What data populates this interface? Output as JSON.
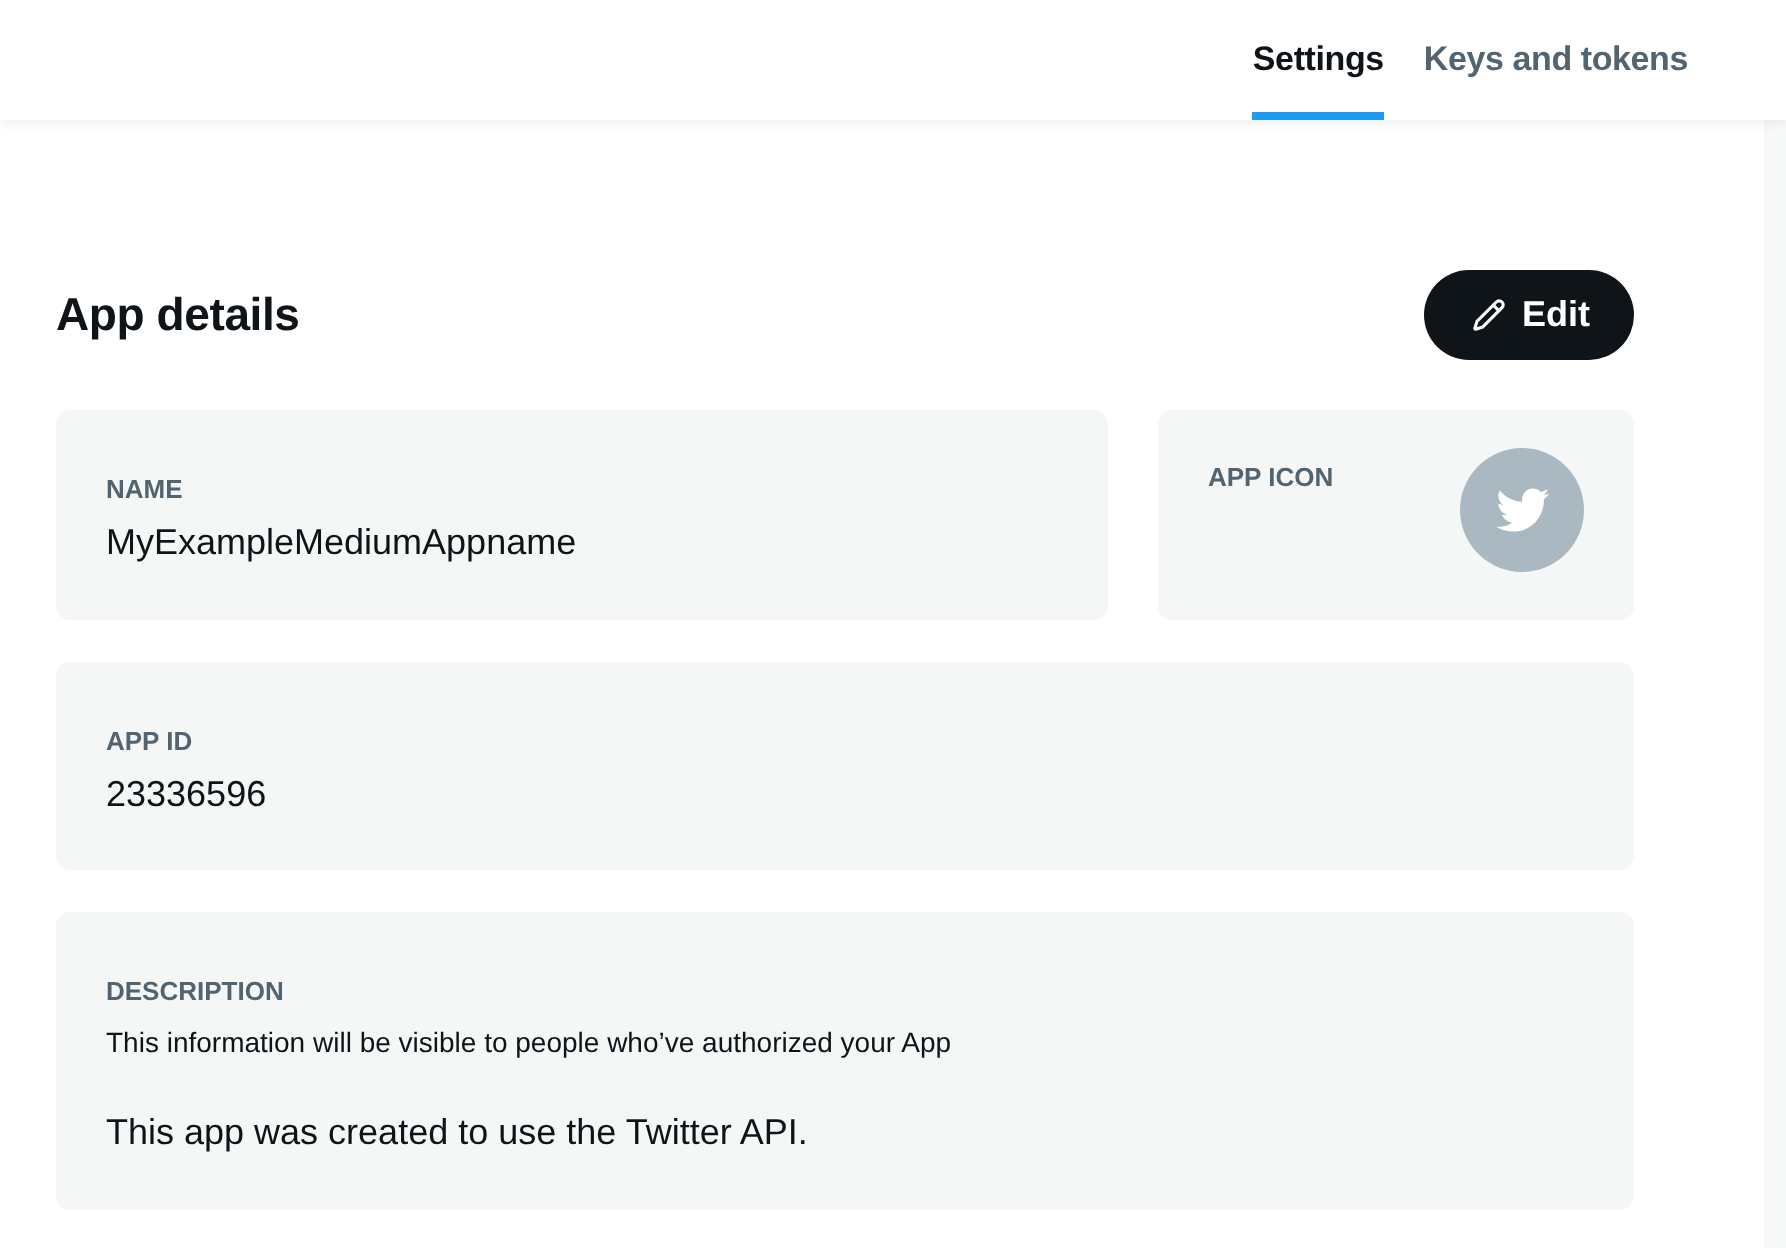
{
  "tabs": [
    {
      "label": "Settings",
      "selected": true
    },
    {
      "label": "Keys and tokens",
      "selected": false
    }
  ],
  "section": {
    "title": "App details",
    "edit_button": "Edit"
  },
  "name_card": {
    "label": "NAME",
    "value": "MyExampleMediumAppname"
  },
  "icon_card": {
    "label": "APP ICON"
  },
  "app_id_card": {
    "label": "APP ID",
    "value": "23336596"
  },
  "description_card": {
    "label": "DESCRIPTION",
    "hint": "This information will be visible to people who’ve authorized your App",
    "value": "This app was created to use the Twitter API."
  }
}
